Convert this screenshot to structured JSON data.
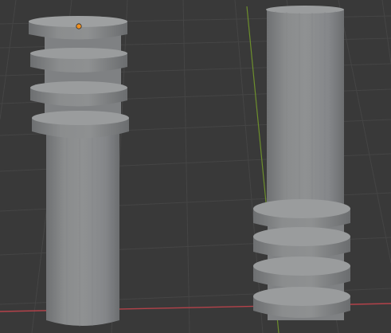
{
  "viewport": {
    "background": "#393939",
    "grid_color": "#444444",
    "x_axis_color": "#c0404a",
    "y_axis_color": "#6c8f2a",
    "origin_color": "#f0901f",
    "mesh_color": "#8c8e8f"
  },
  "objects": [
    {
      "name": "left-cylinder",
      "rings_position": "top",
      "ring_count": 4,
      "selected": true,
      "origin_visible": true
    },
    {
      "name": "right-cylinder",
      "rings_position": "bottom",
      "ring_count": 4,
      "selected": false,
      "origin_visible": false
    }
  ]
}
